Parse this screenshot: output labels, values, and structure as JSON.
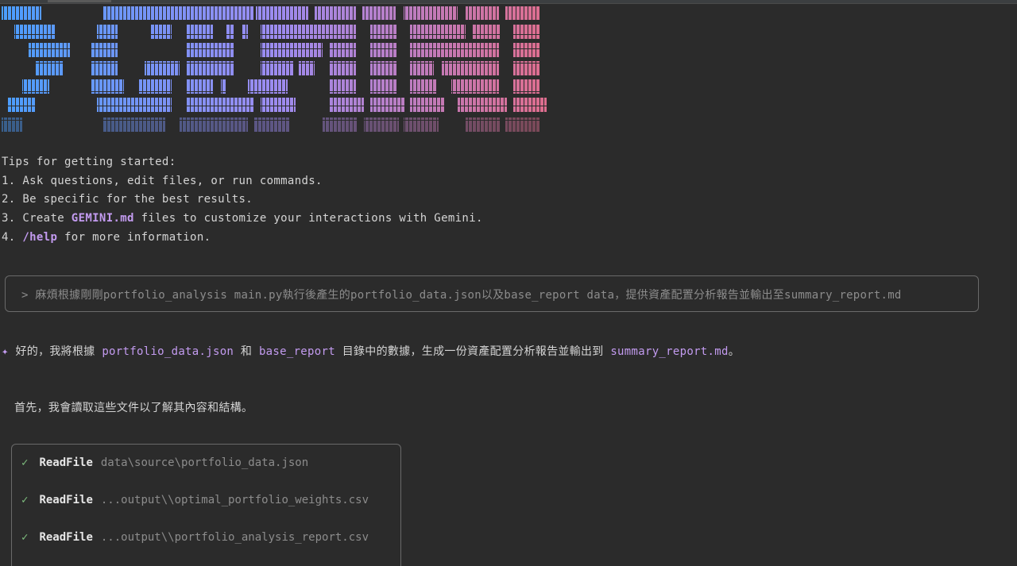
{
  "tips": {
    "heading": "Tips for getting started:",
    "items": [
      {
        "prefix": "1. ",
        "highlight": "",
        "text": "Ask questions, edit files, or run commands."
      },
      {
        "prefix": "2. ",
        "highlight": "",
        "text": "Be specific for the best results."
      },
      {
        "prefix": "3. Create ",
        "highlight": "GEMINI.md",
        "text": " files to customize your interactions with Gemini."
      },
      {
        "prefix": "4. ",
        "highlight": "/help",
        "text": " for more information."
      }
    ]
  },
  "prompt": {
    "marker": ">",
    "text": "麻煩根據剛剛portfolio_analysis main.py執行後產生的portfolio_data.json以及base_report data，提供資產配置分析報告並輸出至summary_report.md"
  },
  "reply": {
    "star": "✦",
    "part1": "好的，我將根據 ",
    "code1": "portfolio_data.json",
    "part2": " 和 ",
    "code2": "base_report",
    "part3": " 目錄中的數據，生成一份資產配置分析報告並輸出到 ",
    "code3": "summary_report.md",
    "part4": "。"
  },
  "note": "首先，我會讀取這些文件以了解其內容和結構。",
  "tools": [
    {
      "status": "✓",
      "name": "ReadFile",
      "arg": "data\\source\\portfolio_data.json"
    },
    {
      "status": "✓",
      "name": "ReadFile",
      "arg": "...output\\\\optimal_portfolio_weights.csv"
    },
    {
      "status": "✓",
      "name": "ReadFile",
      "arg": "...output\\\\portfolio_analysis_report.csv"
    }
  ],
  "colors": {
    "background": "#2b2b2b",
    "accent": "#c39bf0",
    "logo_start": "#4a9eff",
    "logo_end": "#e06c8a"
  }
}
